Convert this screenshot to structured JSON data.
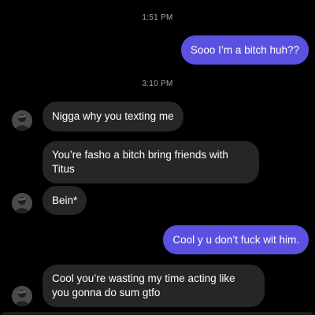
{
  "conversation": {
    "timestamp_1": "1:51 PM",
    "timestamp_2": "3:10 PM",
    "messages": [
      {
        "direction": "outgoing",
        "text": "Sooo I’m a bitch huh??"
      },
      {
        "direction": "incoming",
        "text": "Nigga why you texting me"
      },
      {
        "direction": "incoming",
        "text": "You’re fasho a bitch bring friends with Titus"
      },
      {
        "direction": "incoming",
        "text": "Bein*"
      },
      {
        "direction": "outgoing",
        "text": "Cool y u don’t fuck wit him."
      },
      {
        "direction": "incoming",
        "text": "Cool you’re wasting my time acting like you gonna do sum gtfo"
      }
    ]
  },
  "colors": {
    "background": "#000000",
    "outgoing_bubble": "#5b51e0",
    "incoming_bubble": "#262626",
    "timestamp_text": "#a8a8a8"
  },
  "icons": {
    "avatar": "contact-avatar-icon"
  }
}
